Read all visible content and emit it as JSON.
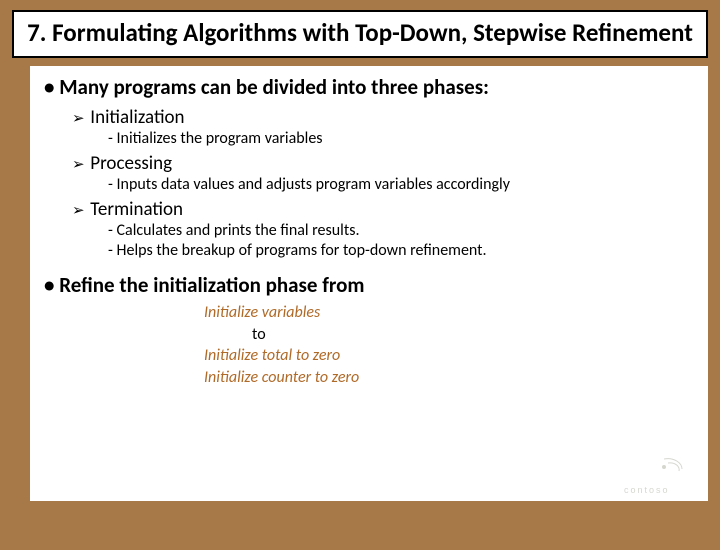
{
  "title": "7. Formulating Algorithms with Top-Down, Stepwise Refinement",
  "bullet1": "• Many programs can be divided into three phases:",
  "phases": [
    {
      "name": "Initialization",
      "subs": [
        "Initializes the program variables"
      ]
    },
    {
      "name": "Processing",
      "subs": [
        "Inputs data values and adjusts program variables accordingly"
      ]
    },
    {
      "name": "Termination",
      "subs": [
        "Calculates and prints the final results.",
        "Helps the breakup of programs for top-down refinement."
      ]
    }
  ],
  "bullet2": "• Refine the initialization phase from",
  "refine": {
    "from": "Initialize variables",
    "to_word": "to",
    "line1": "Initialize total to zero",
    "line2": "Initialize counter to zero"
  },
  "logo_text": "contoso"
}
